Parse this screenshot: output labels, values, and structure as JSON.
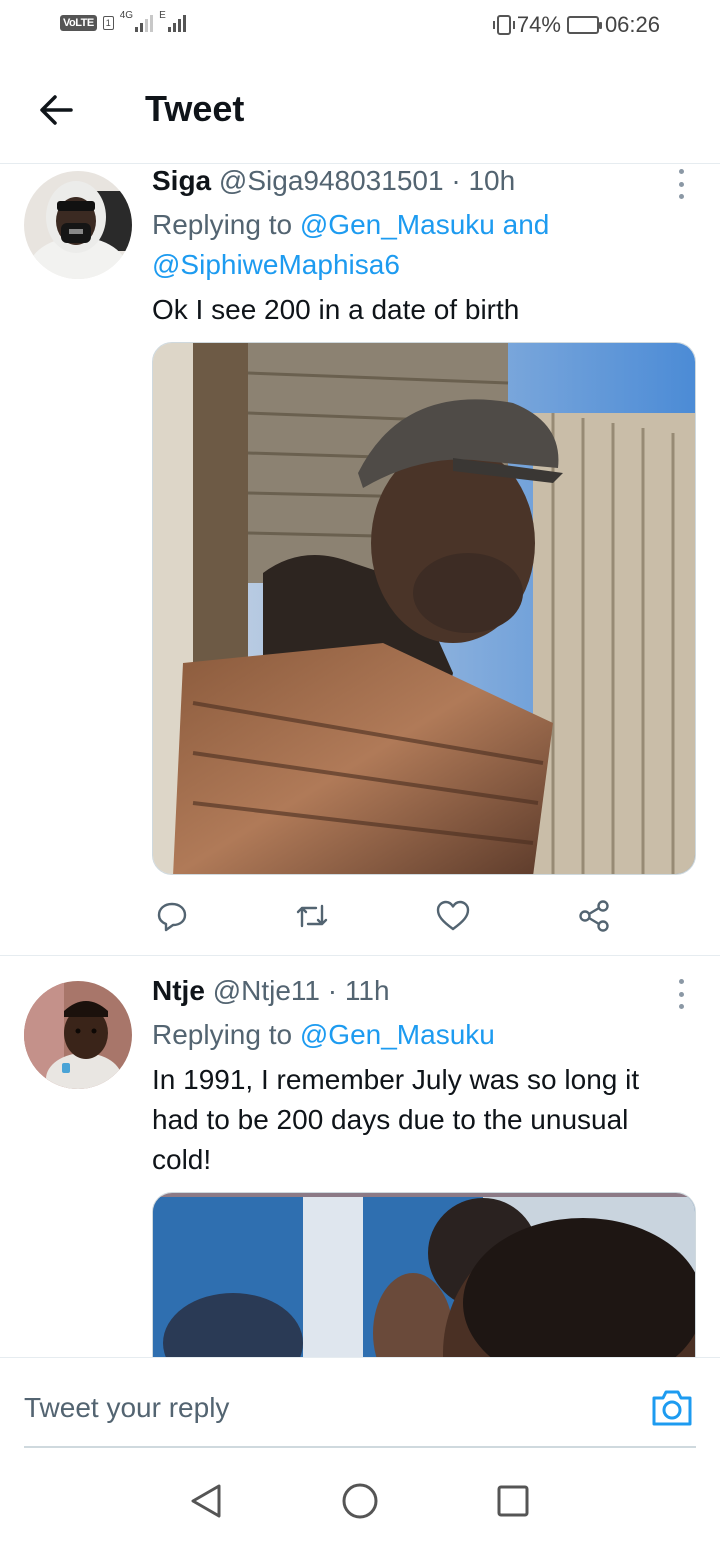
{
  "status_bar": {
    "volte": "VoLTE",
    "sim": "1",
    "network": "4G",
    "network2": "E",
    "battery": "74%",
    "battery_level": 0.74,
    "time": "06:26"
  },
  "header": {
    "title": "Tweet"
  },
  "tweets": [
    {
      "name": "Siga",
      "handle": "@Siga948031501",
      "time": "10h",
      "replying_prefix": "Replying to",
      "mentions": [
        "@Gen_Masuku",
        "and",
        "@SiphiweMaphisa6"
      ],
      "text": "Ok I see 200 in a date of birth",
      "avatar_icon": "avatar-masked-person",
      "media_icon": "photo-man-in-cap"
    },
    {
      "name": "Ntje",
      "handle": "@Ntje11",
      "time": "11h",
      "replying_prefix": "Replying to",
      "mentions": [
        "@Gen_Masuku"
      ],
      "text": "In 1991, I remember July was so long it had to be 200 days due to the unusual cold!",
      "avatar_icon": "avatar-child",
      "media_icon": "photo-person"
    }
  ],
  "reply": {
    "placeholder": "Tweet your reply"
  },
  "colors": {
    "accent": "#1d9bf0",
    "text": "#0f1419",
    "secondary": "#536471"
  },
  "icons": [
    "back-arrow-icon",
    "more-vertical-icon",
    "reply-icon",
    "retweet-icon",
    "like-icon",
    "share-icon",
    "camera-icon",
    "nav-back-icon",
    "nav-home-icon",
    "nav-recents-icon"
  ]
}
